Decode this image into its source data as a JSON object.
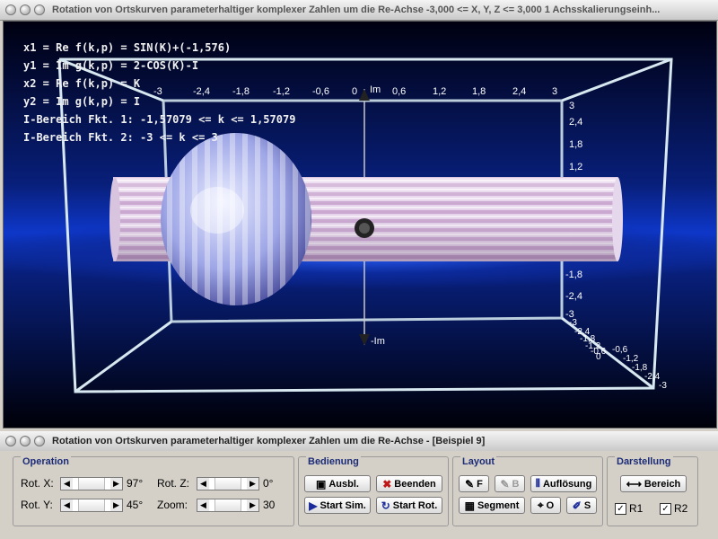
{
  "top_window": {
    "title": "Rotation von Ortskurven parameterhaltiger komplexer Zahlen um die Re-Achse    -3,000 <= X, Y, Z <= 3,000    1 Achsskalierungseinh..."
  },
  "formulas": [
    "x1 = Re f(k,p) = SIN(K)+(-1,576)",
    "y1 = Im g(k,p) = 2-COS(K)-I",
    "x2 = Re f(k,p) = K",
    "y2 = Im g(k,p) = I",
    "I-Bereich Fkt. 1: -1,57079 <= k <= 1,57079",
    "I-Bereich Fkt. 2: -3 <= k <= 3"
  ],
  "axes": {
    "top_ticks": [
      "-3",
      "-2,4",
      "-1,8",
      "-1,2",
      "-0,6",
      "0",
      "0,6",
      "1,2",
      "1,8",
      "2,4",
      "3"
    ],
    "im_label": "Im",
    "neg_im_label": "-Im",
    "right_ticks_upper": [
      "3",
      "2,4",
      "1,8",
      "1,2"
    ],
    "right_ticks_lower": [
      "-1,8",
      "-2,4",
      "-3"
    ],
    "corner_labels": [
      "-3",
      "-2,4",
      "-1,8",
      "-1,2",
      "-0,6",
      "0"
    ],
    "diag_labels": [
      "-0,6",
      "-1,2",
      "-1,8",
      "-2,4",
      "-3"
    ]
  },
  "bottom_window": {
    "title": "Rotation von Ortskurven parameterhaltiger komplexer Zahlen um die Re-Achse - [Beispiel 9]"
  },
  "operation": {
    "title": "Operation",
    "rot_x_label": "Rot. X:",
    "rot_x_value": "97°",
    "rot_y_label": "Rot. Y:",
    "rot_y_value": "45°",
    "rot_z_label": "Rot. Z:",
    "rot_z_value": "0°",
    "zoom_label": "Zoom:",
    "zoom_value": "30"
  },
  "bedienung": {
    "title": "Bedienung",
    "ausbl": "Ausbl.",
    "beenden": "Beenden",
    "start_sim": "Start Sim.",
    "start_rot": "Start Rot."
  },
  "layout": {
    "title": "Layout",
    "f": "F",
    "b": "B",
    "aufloesung": "Auflösung",
    "segment": "Segment",
    "o": "O",
    "s": "S"
  },
  "darstellung": {
    "title": "Darstellung",
    "bereich": "Bereich",
    "r1": "R1",
    "r2": "R2"
  },
  "colors": {
    "accent": "#1c2c77",
    "background": "#0e37c9"
  }
}
